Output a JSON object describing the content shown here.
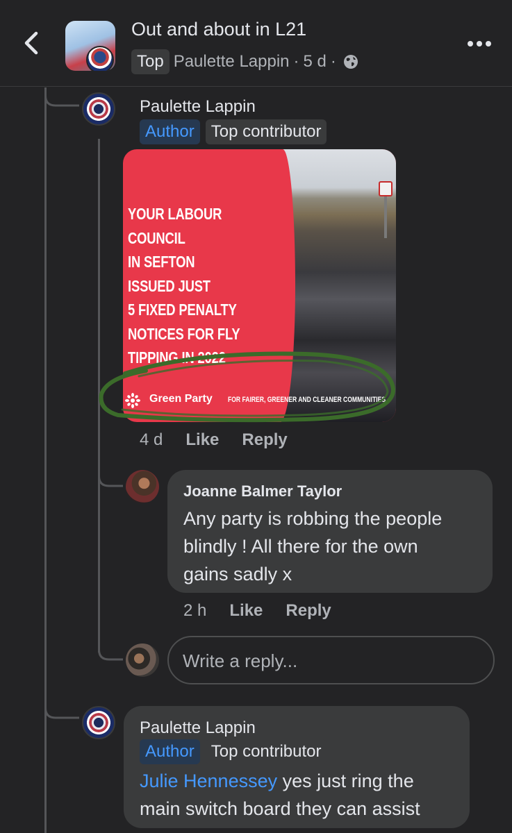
{
  "header": {
    "title": "Out and about in L21",
    "sort_badge": "Top",
    "poster_name": "Paulette Lappin",
    "separator": "·",
    "age": "5 d",
    "separator2": "·"
  },
  "comments": [
    {
      "author": "Paulette Lappin",
      "badges": [
        "Author",
        "Top contributor"
      ],
      "image": {
        "headline": "YOUR LABOUR COUNCIL\nIN SEFTON\nISSUED JUST\n5 FIXED PENALTY\nNOTICES FOR FLY\nTIPPING IN 2022",
        "party_name": "Green Party",
        "tagline": "FOR FAIRER, GREENER AND CLEANER COMMUNITIES"
      },
      "time": "4 d",
      "like_label": "Like",
      "reply_label": "Reply"
    },
    {
      "author": "Joanne Balmer Taylor",
      "text": "Any party is robbing the people\nblindly ! All there for the own\ngains sadly x",
      "time": "2 h",
      "like_label": "Like",
      "reply_label": "Reply"
    },
    {
      "author": "Paulette Lappin",
      "badges": [
        "Author",
        "Top contributor"
      ],
      "mention": "Julie Hennessey",
      "text_line1_rest": " yes just ring the",
      "text_line2": "main switch board they can assist"
    }
  ],
  "reply_box": {
    "placeholder": "Write a reply..."
  },
  "colors": {
    "background": "#232325",
    "bubble": "#3a3b3c",
    "author_badge_text": "#4599ff",
    "mention": "#4599ff",
    "poster_red": "#e8384a",
    "scribble_green": "#3b6b2a"
  }
}
